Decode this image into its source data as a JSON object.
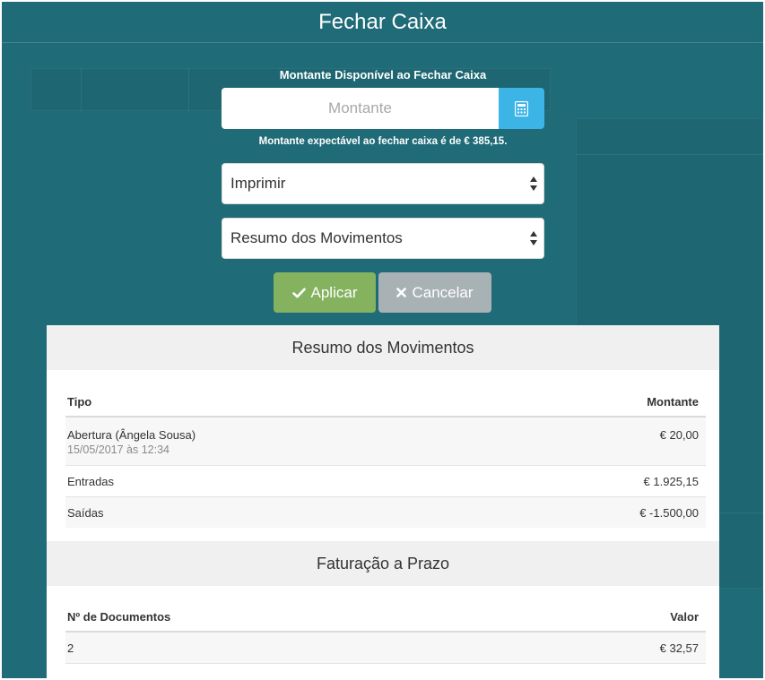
{
  "dialog": {
    "title": "Fechar Caixa",
    "amount_heading": "Montante Disponível ao Fechar Caixa",
    "amount_placeholder": "Montante",
    "expected_note": "Montante expectável ao fechar caixa é de € 385,15.",
    "print_select_value": "Imprimir",
    "report_select_value": "Resumo dos Movimentos",
    "apply_label": "Aplicar",
    "cancel_label": "Cancelar"
  },
  "icons": {
    "calculator": "calculator-icon",
    "apply": "check-icon",
    "cancel": "close-icon",
    "select": "sort-arrows-icon"
  },
  "colors": {
    "background": "#1f6b78",
    "calculator_button": "#3cb4e5",
    "apply_button": "#85b25f",
    "cancel_button": "#a8b1b4"
  },
  "summary": {
    "title": "Resumo dos Movimentos",
    "headers": {
      "type": "Tipo",
      "amount": "Montante"
    },
    "rows": [
      {
        "type": "Abertura (Ângela Sousa)",
        "detail": "15/05/2017 às 12:34",
        "amount": "€ 20,00"
      },
      {
        "type": "Entradas",
        "amount": "€ 1.925,15"
      },
      {
        "type": "Saídas",
        "amount": "€ -1.500,00"
      }
    ]
  },
  "credit": {
    "title": "Faturação a Prazo",
    "headers": {
      "count": "Nº de Documentos",
      "value": "Valor"
    },
    "rows": [
      {
        "count": "2",
        "value": "€ 32,57"
      }
    ]
  }
}
